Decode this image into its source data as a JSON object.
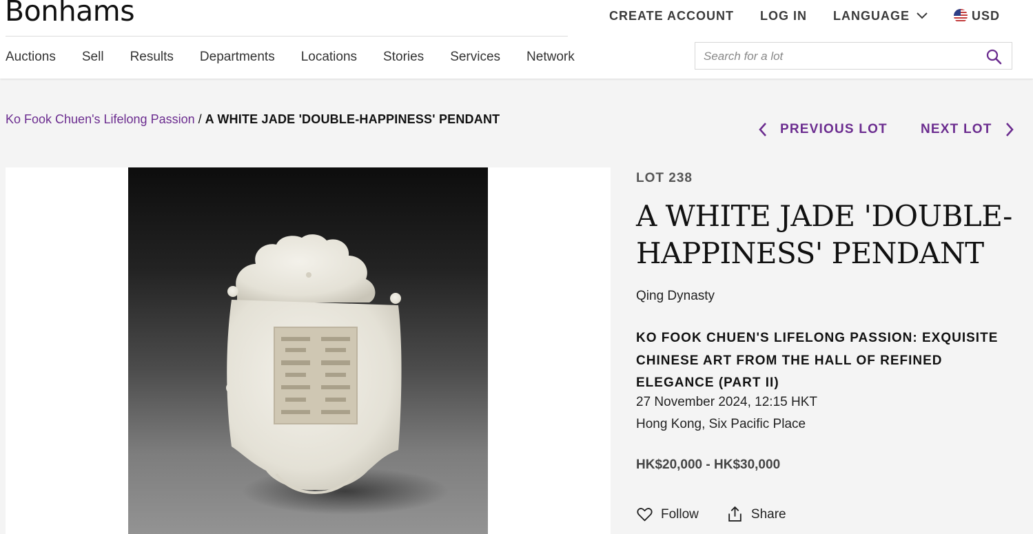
{
  "header": {
    "logo": "Bonhams",
    "top_links": {
      "create_account": "CREATE ACCOUNT",
      "log_in": "LOG IN",
      "language": "LANGUAGE",
      "currency": "USD"
    },
    "nav": [
      "Auctions",
      "Sell",
      "Results",
      "Departments",
      "Locations",
      "Stories",
      "Services",
      "Network"
    ],
    "search": {
      "placeholder": "Search for a lot",
      "value": ""
    }
  },
  "breadcrumb": {
    "parent": "Ko Fook Chuen's Lifelong Passion",
    "separator": " / ",
    "current": "A WHITE JADE 'DOUBLE-HAPPINESS' PENDANT"
  },
  "lot_nav": {
    "previous": "PREVIOUS LOT",
    "next": "NEXT LOT"
  },
  "lot": {
    "number": "LOT 238",
    "title": "A WHITE JADE 'DOUBLE-HAPPINESS' PENDANT",
    "subtitle": "Qing Dynasty",
    "sale_title": "KO FOOK CHUEN'S LIFELONG PASSION: EXQUISITE CHINESE ART FROM THE HALL OF REFINED ELEGANCE (PART II)",
    "date": "27 November 2024, 12:15 HKT",
    "location": "Hong Kong, Six Pacific Place",
    "estimate": "HK$20,000 - HK$30,000"
  },
  "actions": {
    "follow": "Follow",
    "share": "Share"
  },
  "colors": {
    "accent": "#6b2c8f",
    "background": "#f4f4f4",
    "header_bg": "#ffffff"
  }
}
